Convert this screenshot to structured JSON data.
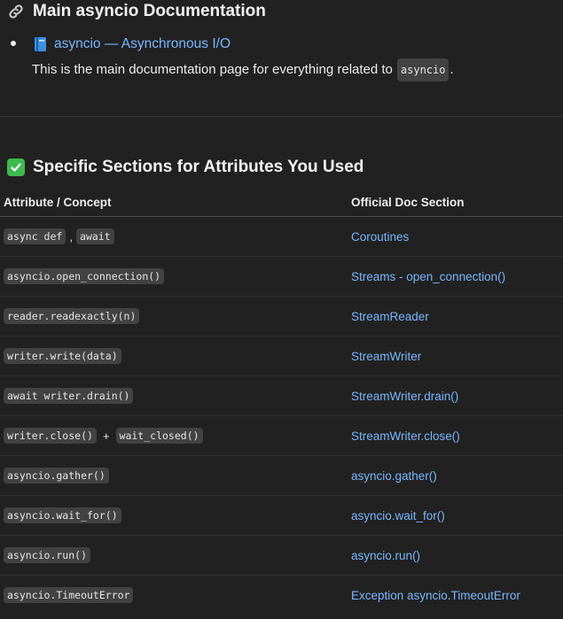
{
  "section1": {
    "heading": "Main asyncio Documentation",
    "link_text": "asyncio — Asynchronous I/O",
    "desc_before": "This is the main documentation page for everything related to ",
    "desc_code": "asyncio",
    "desc_after": "."
  },
  "section2": {
    "heading": "Specific Sections for Attributes You Used"
  },
  "table": {
    "headers": [
      "Attribute / Concept",
      "Official Doc Section"
    ],
    "rows": [
      {
        "code": [
          "async def",
          "await"
        ],
        "sep": ",",
        "doc": "Coroutines"
      },
      {
        "code": [
          "asyncio.open_connection()"
        ],
        "doc": "Streams - open_connection()"
      },
      {
        "code": [
          "reader.readexactly(n)"
        ],
        "doc": "StreamReader"
      },
      {
        "code": [
          "writer.write(data)"
        ],
        "doc": "StreamWriter"
      },
      {
        "code": [
          "await writer.drain()"
        ],
        "doc": "StreamWriter.drain()"
      },
      {
        "code": [
          "writer.close()",
          "wait_closed()"
        ],
        "sep": "+",
        "doc": "StreamWriter.close()"
      },
      {
        "code": [
          "asyncio.gather()"
        ],
        "doc": "asyncio.gather()"
      },
      {
        "code": [
          "asyncio.wait_for()"
        ],
        "doc": "asyncio.wait_for()"
      },
      {
        "code": [
          "asyncio.run()"
        ],
        "doc": "asyncio.run()"
      },
      {
        "code": [
          "asyncio.TimeoutError"
        ],
        "doc": "Exception asyncio.TimeoutError"
      }
    ]
  },
  "colors": {
    "background": "#212121",
    "link": "#7ab7ff",
    "code_bg": "#424242",
    "check": "#3fb950"
  }
}
